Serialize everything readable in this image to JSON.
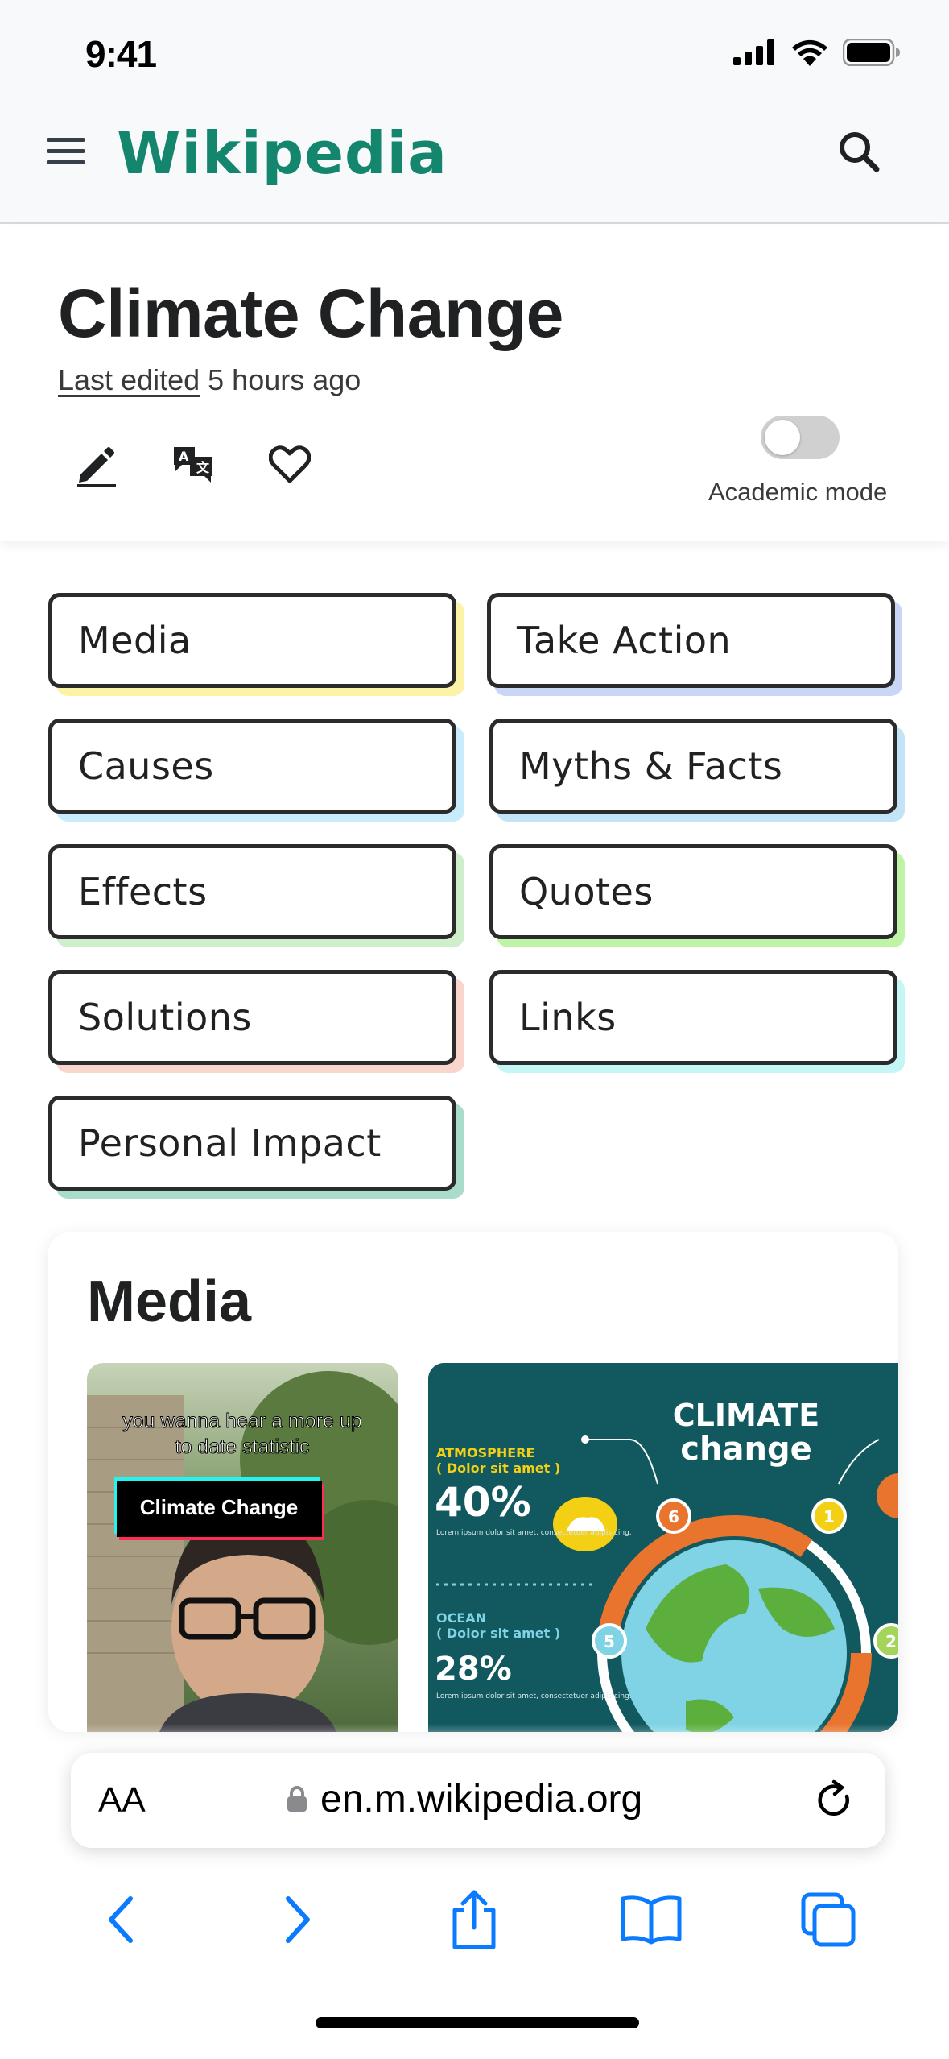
{
  "status_bar": {
    "time": "9:41"
  },
  "header": {
    "logo": "Wikipedia"
  },
  "article": {
    "title": "Climate Change",
    "last_edited_link": "Last edited",
    "last_edited_time": "5 hours ago",
    "academic_mode_label": "Academic mode",
    "academic_mode_on": false
  },
  "categories": [
    {
      "label": "Media",
      "shadow": "#fdf3a7"
    },
    {
      "label": "Take Action",
      "shadow": "#c9d6f5"
    },
    {
      "label": "Causes",
      "shadow": "#c8ecfb"
    },
    {
      "label": "Myths & Facts",
      "shadow": "#c3e4f7"
    },
    {
      "label": "Effects",
      "shadow": "#cfeecb"
    },
    {
      "label": "Quotes",
      "shadow": "#bff4a6"
    },
    {
      "label": "Solutions",
      "shadow": "#f9d5cc"
    },
    {
      "label": "Links",
      "shadow": "#c5f6f6"
    },
    {
      "label": "Personal Impact",
      "shadow": "#a9dccb"
    }
  ],
  "media": {
    "heading": "Media",
    "video_caption_1": "you wanna hear a more up",
    "video_caption_2": "to date statistic",
    "video_tag": "Climate Change",
    "infographic": {
      "title_1": "CLIMATE",
      "title_2": "change",
      "atm_label": "ATMOSPHERE",
      "atm_sub": "( Dolor sit amet )",
      "atm_value": "40%",
      "ocean_label": "OCEAN",
      "ocean_sub": "( Dolor sit amet )",
      "ocean_value": "28%",
      "lorem": "Lorem ipsum dolor sit amet, consectetuer adipis cing.",
      "marker_6": "6",
      "marker_1": "1",
      "marker_5": "5",
      "marker_2": "2"
    }
  },
  "browser": {
    "aa_label": "AA",
    "url": "en.m.wikipedia.org"
  },
  "colors": {
    "brand": "#14866d",
    "ios_blue": "#0a7aff"
  }
}
